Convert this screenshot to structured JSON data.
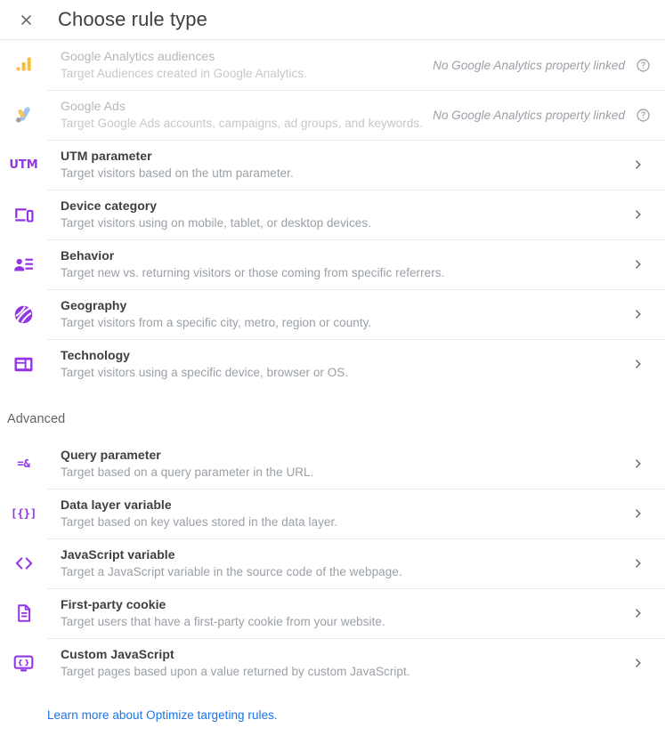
{
  "header": {
    "title": "Choose rule type",
    "close_icon": "close-icon"
  },
  "primary_rules": [
    {
      "icon": "google-analytics-icon",
      "title": "Google Analytics audiences",
      "subtitle": "Target Audiences created in Google Analytics.",
      "status": "No Google Analytics property linked",
      "help_icon": "help-circle-icon",
      "disabled": true
    },
    {
      "icon": "google-ads-icon",
      "title": "Google Ads",
      "subtitle": "Target Google Ads accounts, campaigns, ad groups, and keywords.",
      "status": "No Google Analytics property linked",
      "help_icon": "help-circle-icon",
      "disabled": true
    },
    {
      "icon": "utm-icon",
      "icon_glyph": "UTM",
      "title": "UTM parameter",
      "subtitle": "Target visitors based on the utm parameter.",
      "chevron": "chevron-right-icon",
      "disabled": false
    },
    {
      "icon": "device-category-icon",
      "title": "Device category",
      "subtitle": "Target visitors using on mobile, tablet, or desktop devices.",
      "chevron": "chevron-right-icon",
      "disabled": false
    },
    {
      "icon": "behavior-icon",
      "title": "Behavior",
      "subtitle": "Target new vs. returning visitors or those coming from specific referrers.",
      "chevron": "chevron-right-icon",
      "disabled": false
    },
    {
      "icon": "geography-icon",
      "title": "Geography",
      "subtitle": "Target visitors from a specific city, metro, region or county.",
      "chevron": "chevron-right-icon",
      "disabled": false
    },
    {
      "icon": "technology-icon",
      "title": "Technology",
      "subtitle": "Target visitors using a specific device, browser or OS.",
      "chevron": "chevron-right-icon",
      "disabled": false
    }
  ],
  "advanced": {
    "heading": "Advanced",
    "rules": [
      {
        "icon": "query-parameter-icon",
        "icon_glyph": "=&",
        "title": "Query parameter",
        "subtitle": "Target based on a query parameter in the URL.",
        "chevron": "chevron-right-icon"
      },
      {
        "icon": "data-layer-variable-icon",
        "icon_glyph": "[{}]",
        "title": "Data layer variable",
        "subtitle": "Target based on key values stored in the data layer.",
        "chevron": "chevron-right-icon"
      },
      {
        "icon": "javascript-variable-icon",
        "title": "JavaScript variable",
        "subtitle": "Target a JavaScript variable in the source code of the webpage.",
        "chevron": "chevron-right-icon"
      },
      {
        "icon": "first-party-cookie-icon",
        "title": "First-party cookie",
        "subtitle": "Target users that have a first-party cookie from your website.",
        "chevron": "chevron-right-icon"
      },
      {
        "icon": "custom-javascript-icon",
        "title": "Custom JavaScript",
        "subtitle": "Target pages based upon a value returned by custom JavaScript.",
        "chevron": "chevron-right-icon"
      }
    ]
  },
  "footer": {
    "link_text": "Learn more about Optimize targeting rules."
  },
  "colors": {
    "accent_purple": "#9334e6",
    "link_blue": "#1a73e8",
    "text_primary": "#3c4043",
    "text_secondary": "#9aa0a6",
    "disabled_text": "#b4b8bb",
    "divider": "#e8eaed",
    "ga_orange": "#f9ab00",
    "ads_blue": "#a2c2f5",
    "ads_grey": "#9aa0a6"
  }
}
